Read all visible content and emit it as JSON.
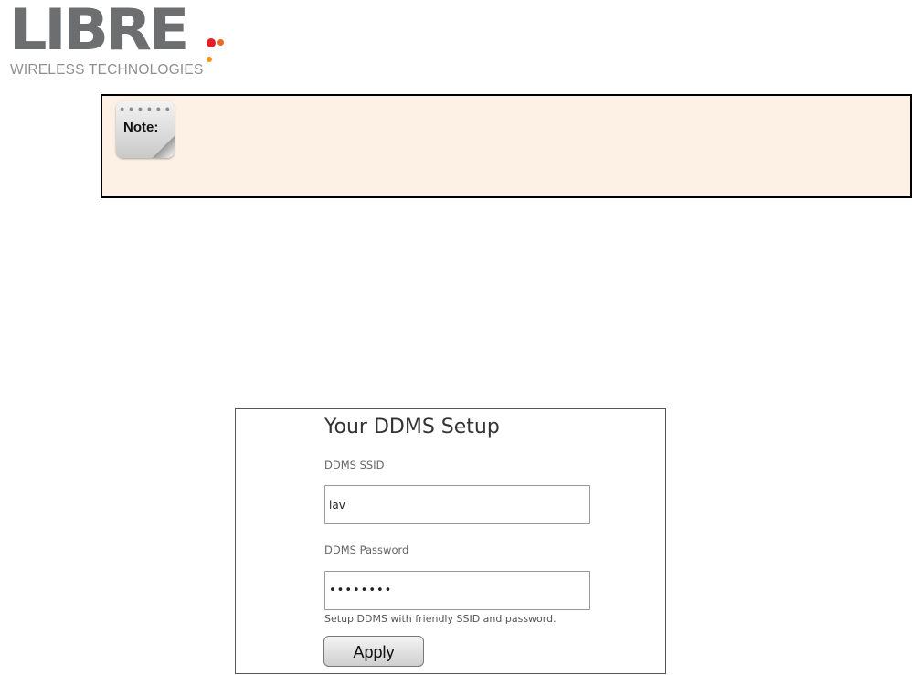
{
  "logo": {
    "wordmark": "LIBRE",
    "tagline": "WIRELESS TECHNOLOGIES",
    "colors": {
      "text": "#6d6e70",
      "dot1": "#e31e24",
      "dot2": "#f26522",
      "dot3": "#f7941d"
    }
  },
  "note": {
    "label": "Note:",
    "icon": "notepad-icon",
    "background": "#fdf1e6"
  },
  "setup": {
    "title": "Your DDMS Setup",
    "ssid_label": "DDMS SSID",
    "ssid_value": "lav",
    "password_label": "DDMS Password",
    "password_value": "••••••••",
    "hint": "Setup DDMS with friendly SSID and password.",
    "apply_label": "Apply"
  }
}
